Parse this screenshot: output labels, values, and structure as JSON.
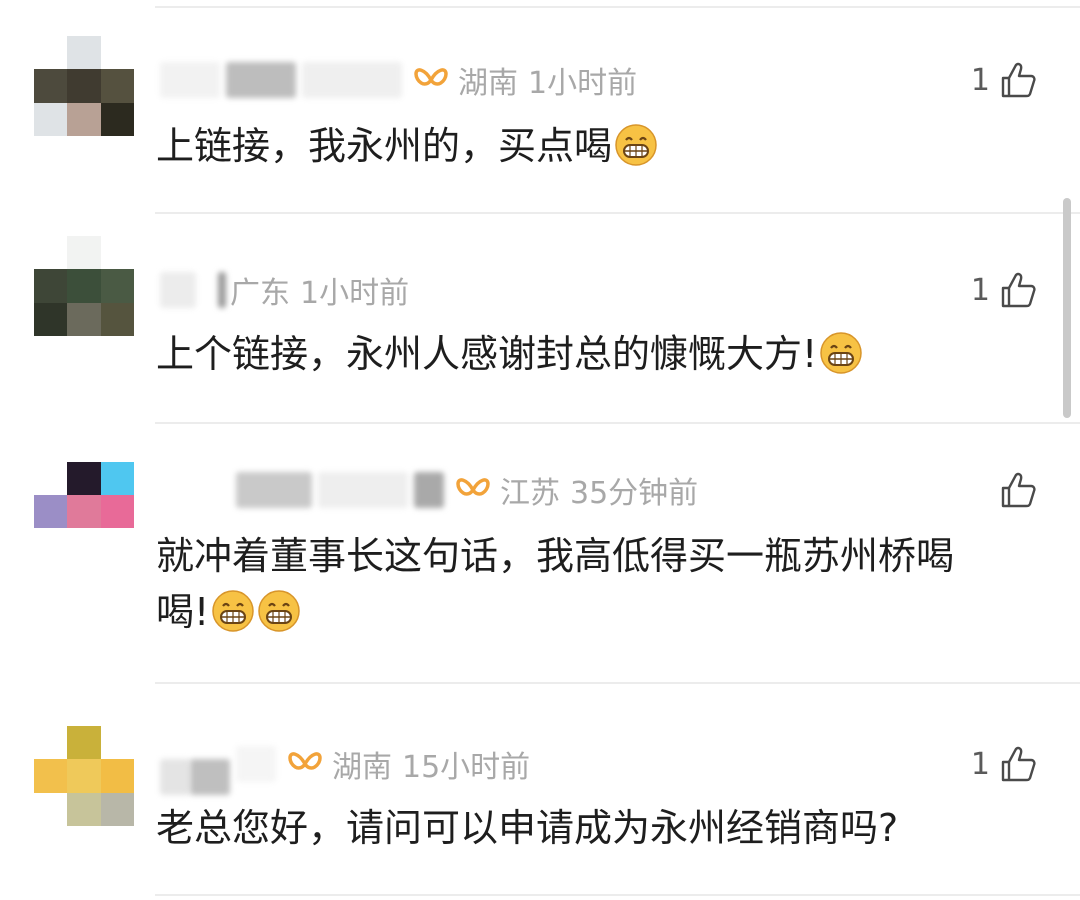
{
  "comments": [
    {
      "location": "湖南",
      "time": "1小时前",
      "likes": "1",
      "has_vip_icon": true,
      "text": "上链接，我永州的，买点喝",
      "emoji": [
        "grinning-face-emoji"
      ]
    },
    {
      "location": "广东",
      "time": "1小时前",
      "likes": "1",
      "has_vip_icon": false,
      "text": "上个链接，永州人感谢封总的慷慨大方!",
      "emoji": [
        "grinning-face-emoji"
      ]
    },
    {
      "location": "江苏",
      "time": "35分钟前",
      "likes": "",
      "has_vip_icon": true,
      "text_line1": "就冲着董事长这句话，我高低得买一瓶苏州桥喝",
      "text_line2": "喝!",
      "emoji": [
        "grinning-face-emoji",
        "grinning-face-emoji"
      ]
    },
    {
      "location": "湖南",
      "time": "15小时前",
      "likes": "1",
      "has_vip_icon": true,
      "text": "老总您好，请问可以申请成为永州经销商吗?",
      "emoji": []
    }
  ],
  "icons": {
    "like": "thumbs-up-icon",
    "vip": "vip-badge-icon",
    "emoji": "grinning-face-emoji"
  },
  "colors": {
    "vip_badge": "#f2a33a",
    "meta_text": "#a8a8a8",
    "body_text": "#1e1e1e",
    "emoji_face": "#f7c244"
  }
}
